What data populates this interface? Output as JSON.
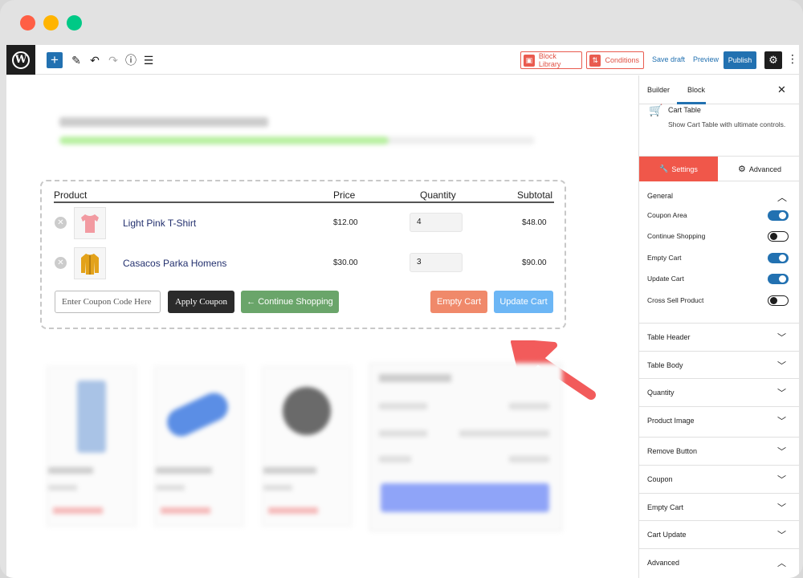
{
  "window": {
    "dots": {
      "close": "#ff5f45",
      "minimize": "#ffb400",
      "maximize": "#00c986"
    }
  },
  "toolbar": {
    "wp_logo_icon": "wordpress-logo",
    "add_label": "+",
    "tools_icon": "pencil-icon",
    "undo_icon": "undo-icon",
    "redo_icon": "redo-icon",
    "info_icon": "info-icon",
    "list_icon": "list-view-icon",
    "block_library_label": "Block Library",
    "conditions_label": "Conditions",
    "save_draft_label": "Save draft",
    "preview_label": "Preview",
    "publish_label": "Publish",
    "accent": "#2271b1",
    "brand": "#e95b4f"
  },
  "cart": {
    "headers": {
      "product": "Product",
      "price": "Price",
      "quantity": "Quantity",
      "subtotal": "Subtotal"
    },
    "items": [
      {
        "name": "Light Pink T-Shirt",
        "price": "$12.00",
        "quantity": "4",
        "subtotal": "$48.00"
      },
      {
        "name": "Casacos Parka Homens",
        "price": "$30.00",
        "quantity": "3",
        "subtotal": "$90.00"
      }
    ],
    "coupon_placeholder": "Enter Coupon Code Here",
    "apply_coupon_label": "Apply Coupon",
    "continue_shopping_label": "← Continue Shopping",
    "empty_cart_label": "Empty Cart",
    "update_cart_label": "Update Cart"
  },
  "sidebar": {
    "tabs": {
      "builder": "Builder",
      "block": "Block"
    },
    "close_label": "✕",
    "block": {
      "title": "Cart Table",
      "description": "Show Cart Table with ultimate controls."
    },
    "panel_tabs": {
      "settings": "Settings",
      "advanced": "Advanced"
    },
    "general": {
      "title": "General",
      "toggles": [
        {
          "label": "Coupon Area",
          "on": true
        },
        {
          "label": "Continue Shopping",
          "on": false
        },
        {
          "label": "Empty Cart",
          "on": true
        },
        {
          "label": "Update Cart",
          "on": true
        },
        {
          "label": "Cross Sell Product",
          "on": false
        }
      ]
    },
    "sections": [
      "Table Header",
      "Table Body",
      "Quantity",
      "Product Image",
      "Remove Button",
      "Coupon",
      "Empty Cart",
      "Cart Update",
      "Advanced"
    ]
  }
}
